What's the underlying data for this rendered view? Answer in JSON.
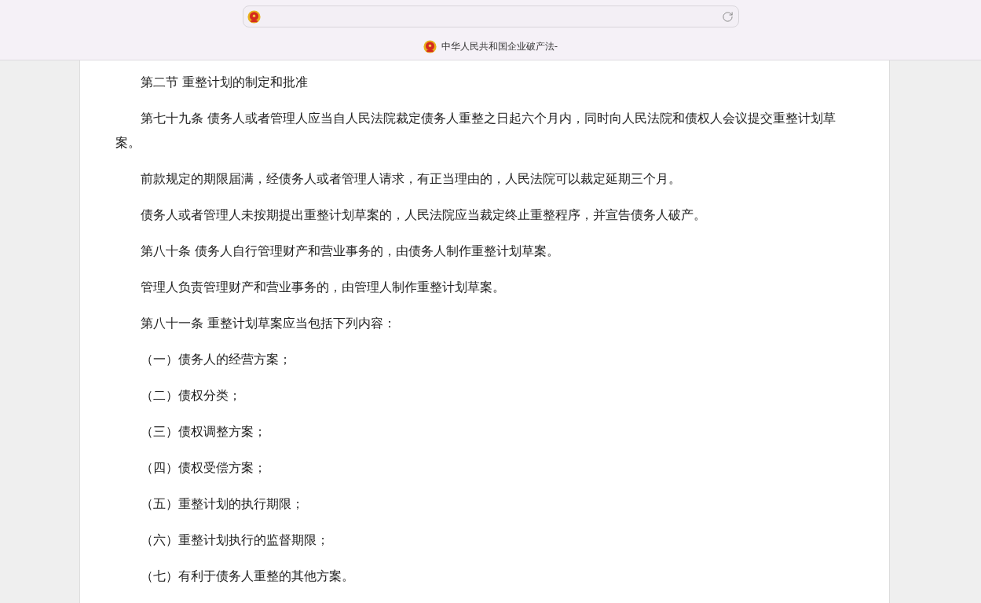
{
  "browser": {
    "tab_title": "中华人民共和国企业破产法-"
  },
  "document": {
    "paragraphs": [
      "第二节 重整计划的制定和批准",
      "第七十九条 债务人或者管理人应当自人民法院裁定债务人重整之日起六个月内，同时向人民法院和债权人会议提交重整计划草案。",
      "前款规定的期限届满，经债务人或者管理人请求，有正当理由的，人民法院可以裁定延期三个月。",
      "债务人或者管理人未按期提出重整计划草案的，人民法院应当裁定终止重整程序，并宣告债务人破产。",
      "第八十条 债务人自行管理财产和营业事务的，由债务人制作重整计划草案。",
      "管理人负责管理财产和营业事务的，由管理人制作重整计划草案。",
      "第八十一条 重整计划草案应当包括下列内容：",
      "（一）债务人的经营方案；",
      "（二）债权分类；",
      "（三）债权调整方案；",
      "（四）债权受偿方案；",
      "（五）重整计划的执行期限；",
      "（六）重整计划执行的监督期限；",
      "（七）有利于债务人重整的其他方案。"
    ]
  }
}
